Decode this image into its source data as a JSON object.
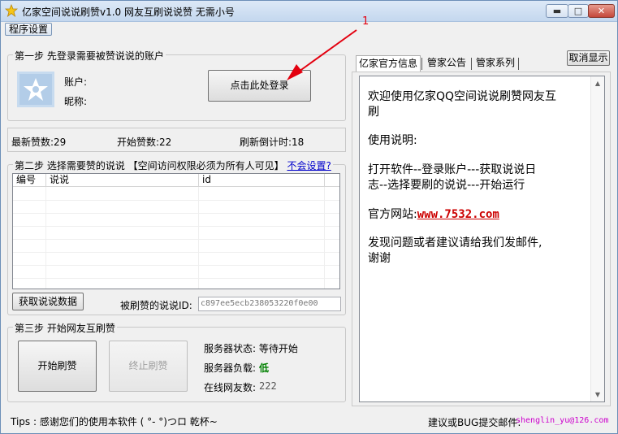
{
  "window": {
    "title": "亿家空间说说刷赞v1.0 网友互刷说说赞 无需小号",
    "minimize_glyph": "▬",
    "maximize_glyph": "□",
    "close_glyph": "✕"
  },
  "menu": {
    "settings": "程序设置"
  },
  "annotation": {
    "number": "1",
    "color": "#e3000f"
  },
  "step1": {
    "legend": "第一步 先登录需要被赞说说的账户",
    "account_label": "账户:",
    "nickname_label": "昵称:",
    "login_button": "点击此处登录"
  },
  "stats": {
    "latest_likes": "最新赞数:29",
    "start_likes": "开始赞数:22",
    "countdown": "刷新倒计时:18"
  },
  "step2": {
    "legend": "第二步 选择需要赞的说说 【空间访问权限必须为所有人可见】",
    "link": "不会设置?",
    "columns": [
      "编号",
      "说说",
      "id"
    ],
    "fetch_button": "获取说说数据",
    "id_label": "被刷赞的说说ID:",
    "id_value": "c897ee5ecb238053220f0e00"
  },
  "step3": {
    "legend": "第三步 开始网友互刷赞",
    "start_button": "开始刷赞",
    "stop_button": "终止刷赞",
    "server_status": "服务器状态: 等待开始",
    "server_load_label": "服务器负载:",
    "server_load_value": "低",
    "online_label": "在线网友数:",
    "online_value": "222"
  },
  "right": {
    "tabs": [
      "亿家官方信息",
      "管家公告",
      "管家系列"
    ],
    "cancel_button": "取消显示",
    "lines": {
      "l1": "欢迎使用亿家QQ空间说说刷赞网友互",
      "l2": "刷",
      "l3": "使用说明:",
      "l4": "打开软件--登录账户---获取说说日",
      "l5": "志--选择要刷的说说---开始运行",
      "l6_label": "官方网站:",
      "l6_link": "www.7532.com",
      "l7": "发现问题或者建议请给我们发邮件,",
      "l8": "谢谢"
    }
  },
  "footer": {
    "tips": "Tips : 感谢您们的使用本软件  ( °- °)つロ  乾杯~",
    "feedback_label": "建议或BUG提交邮件:",
    "email": "shenglin_yu@126.com"
  },
  "colors": {
    "link_red": "#cc0000",
    "load_green": "#008000",
    "email_magenta": "#cc00cc"
  }
}
